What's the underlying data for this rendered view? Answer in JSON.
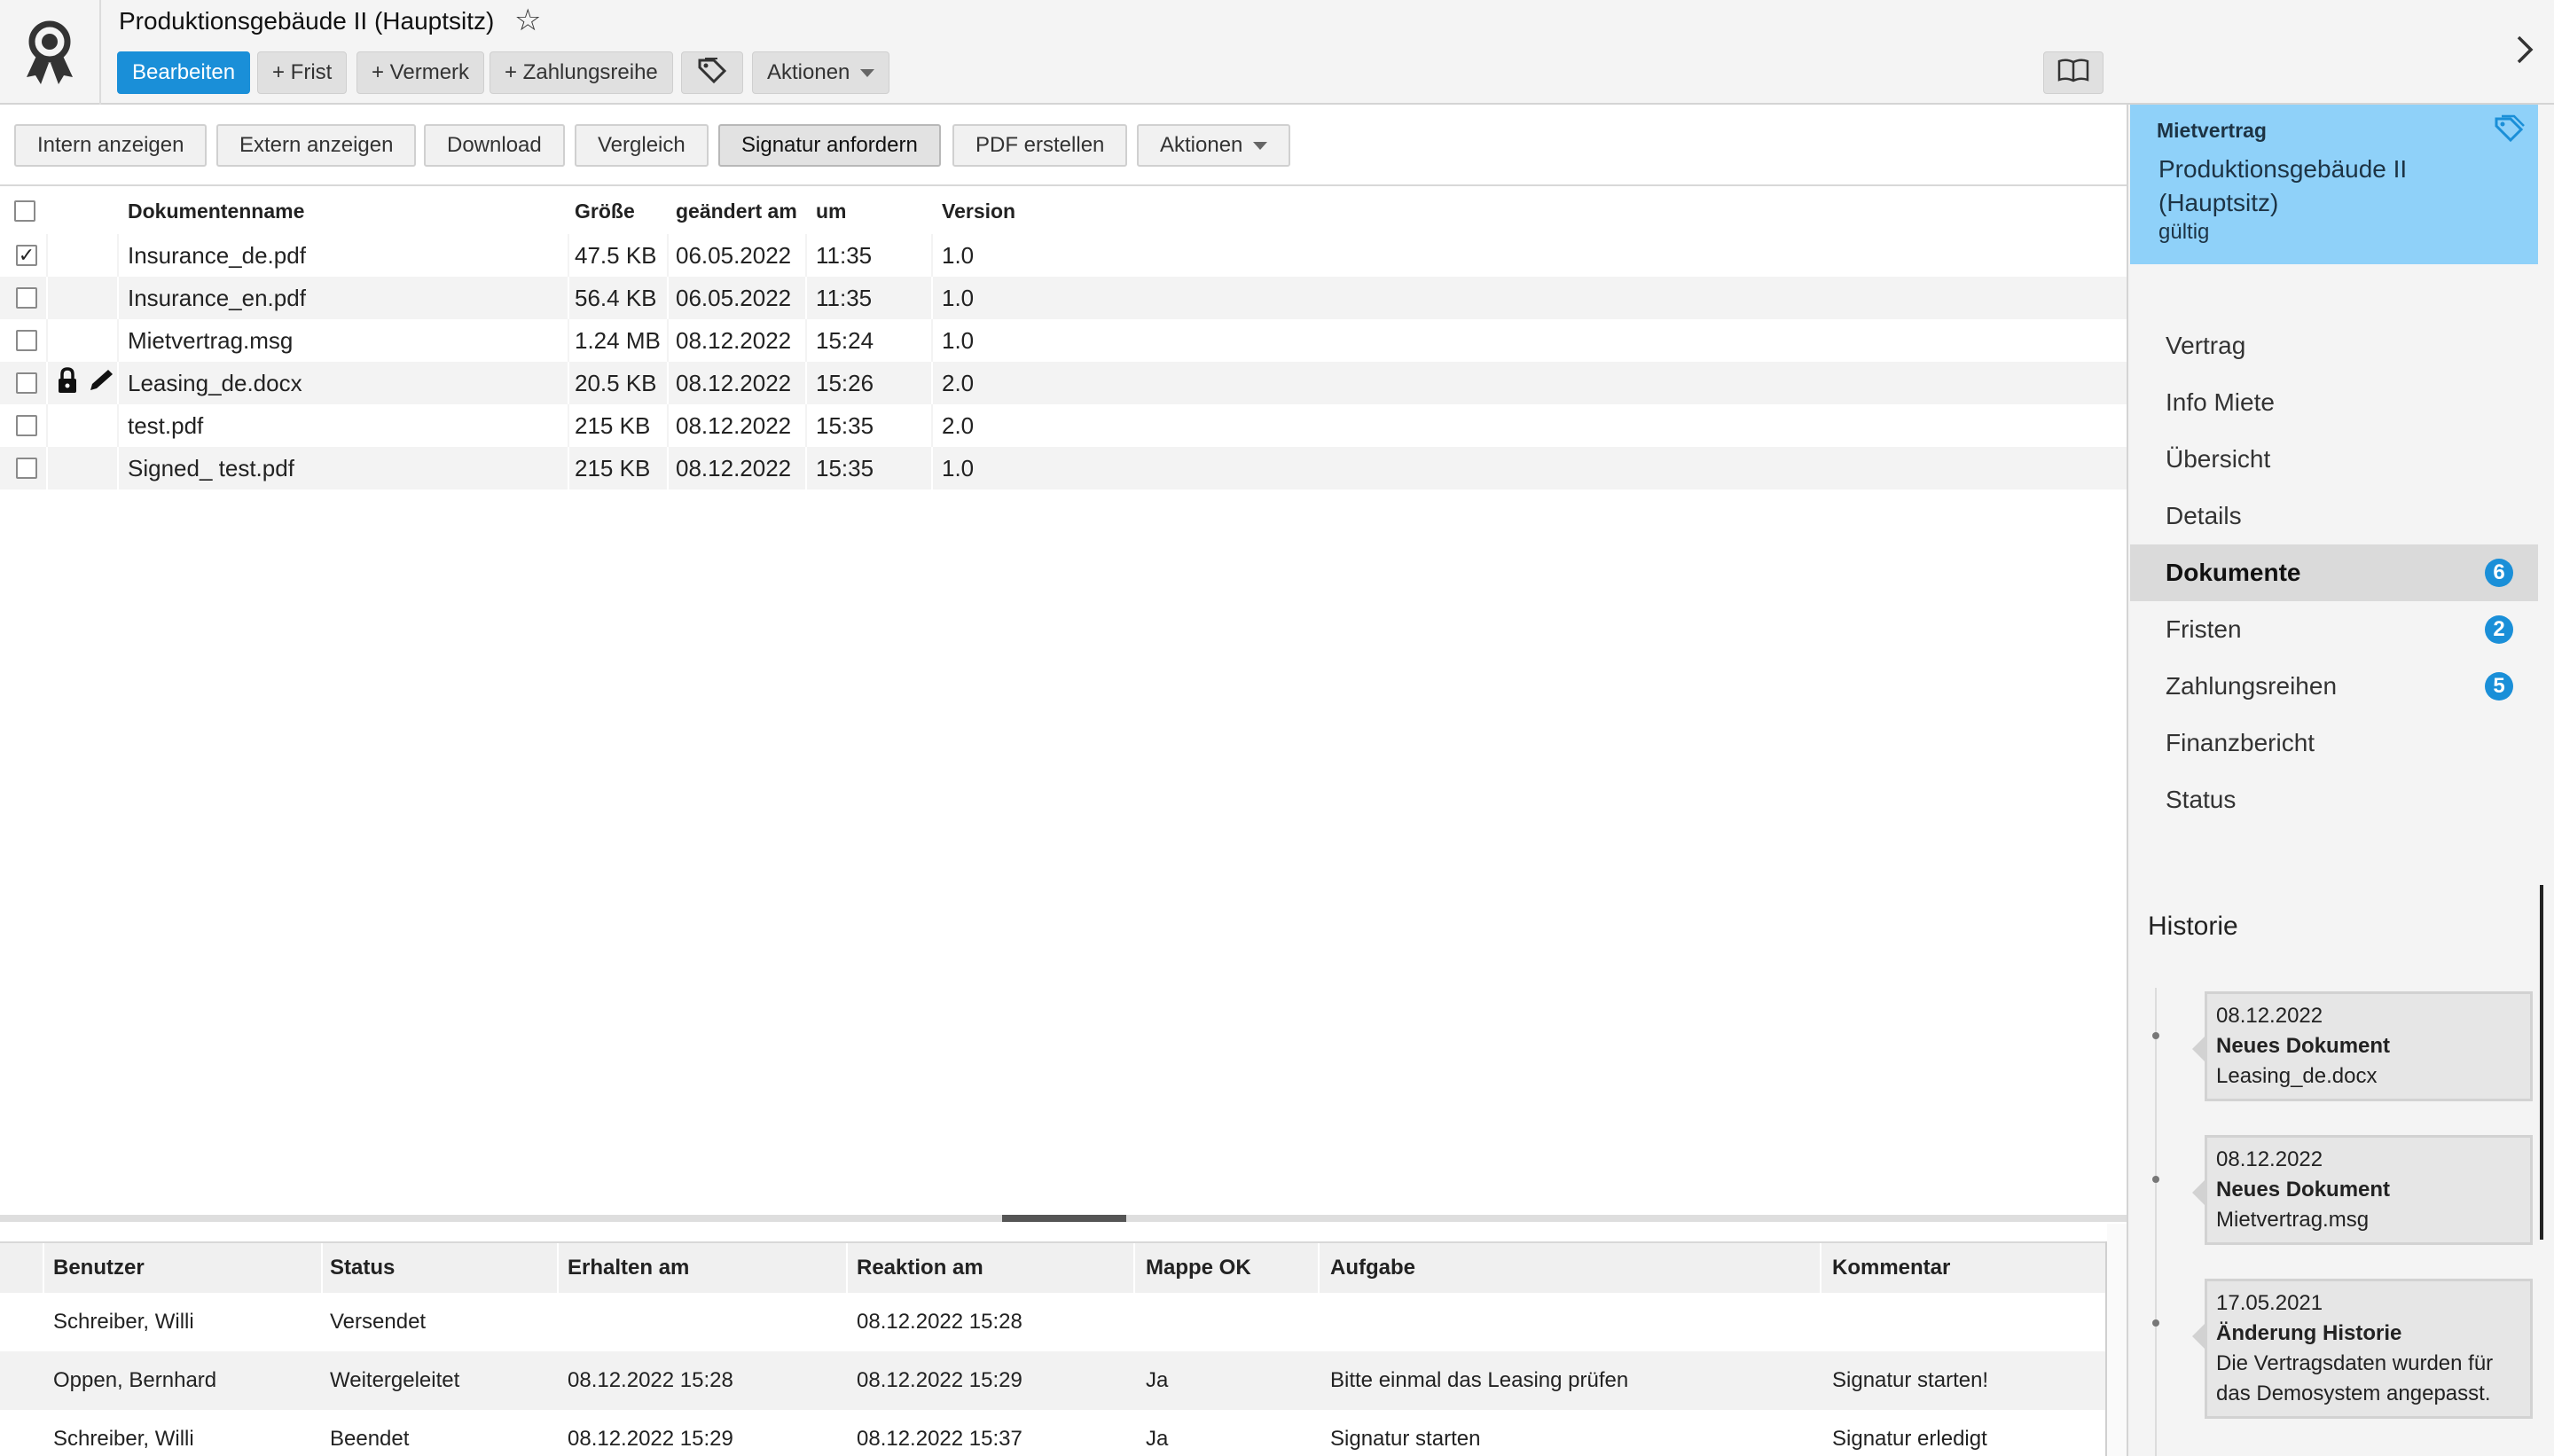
{
  "header": {
    "title": "Produktionsgebäude II (Hauptsitz)",
    "buttons": {
      "edit": "Bearbeiten",
      "deadline": "+ Frist",
      "note": "+ Vermerk",
      "payment": "+ Zahlungsreihe",
      "actions": "Aktionen"
    },
    "icons": [
      "award-logo-icon",
      "star-icon",
      "tags-icon",
      "book-icon",
      "chevron-right-icon"
    ]
  },
  "toolbar": {
    "show_internal": "Intern anzeigen",
    "show_external": "Extern anzeigen",
    "download": "Download",
    "compare": "Vergleich",
    "request_signature": "Signatur anfordern",
    "create_pdf": "PDF erstellen",
    "actions": "Aktionen"
  },
  "documents": {
    "columns": {
      "name": "Dokumentenname",
      "size": "Größe",
      "changed": "geändert am",
      "time": "um",
      "version": "Version"
    },
    "rows": [
      {
        "checked": true,
        "locked": false,
        "name": "Insurance_de.pdf",
        "size": "47.5 KB",
        "date": "06.05.2022",
        "time": "11:35",
        "version": "1.0"
      },
      {
        "checked": false,
        "locked": false,
        "name": "Insurance_en.pdf",
        "size": "56.4 KB",
        "date": "06.05.2022",
        "time": "11:35",
        "version": "1.0"
      },
      {
        "checked": false,
        "locked": false,
        "name": "Mietvertrag.msg",
        "size": "1.24 MB",
        "date": "08.12.2022",
        "time": "15:24",
        "version": "1.0"
      },
      {
        "checked": false,
        "locked": true,
        "name": "Leasing_de.docx",
        "size": "20.5 KB",
        "date": "08.12.2022",
        "time": "15:26",
        "version": "2.0"
      },
      {
        "checked": false,
        "locked": false,
        "name": "test.pdf",
        "size": "215 KB",
        "date": "08.12.2022",
        "time": "15:35",
        "version": "2.0"
      },
      {
        "checked": false,
        "locked": false,
        "name": "Signed_ test.pdf",
        "size": "215 KB",
        "date": "08.12.2022",
        "time": "15:35",
        "version": "1.0"
      }
    ]
  },
  "workflow": {
    "columns": {
      "user": "Benutzer",
      "status": "Status",
      "received": "Erhalten am",
      "reaction": "Reaktion am",
      "folder_ok": "Mappe OK",
      "task": "Aufgabe",
      "comment": "Kommentar"
    },
    "rows": [
      {
        "user": "Schreiber, Willi",
        "status": "Versendet",
        "received": "",
        "reaction": "08.12.2022 15:28",
        "folder_ok": "",
        "task": "",
        "comment": ""
      },
      {
        "user": "Oppen, Bernhard",
        "status": "Weitergeleitet",
        "received": "08.12.2022 15:28",
        "reaction": "08.12.2022 15:29",
        "folder_ok": "Ja",
        "task": "Bitte einmal das Leasing prüfen",
        "comment": "Signatur starten!"
      },
      {
        "user": "Schreiber, Willi",
        "status": "Beendet",
        "received": "08.12.2022 15:29",
        "reaction": "08.12.2022 15:37",
        "folder_ok": "Ja",
        "task": "Signatur starten",
        "comment": "Signatur erledigt"
      }
    ]
  },
  "panel": {
    "contract": {
      "type": "Mietvertrag",
      "name": "Produktionsgebäude II (Hauptsitz)",
      "status": "gültig"
    },
    "nav": [
      {
        "label": "Vertrag",
        "badge": ""
      },
      {
        "label": "Info Miete",
        "badge": ""
      },
      {
        "label": "Übersicht",
        "badge": ""
      },
      {
        "label": "Details",
        "badge": ""
      },
      {
        "label": "Dokumente",
        "badge": "6"
      },
      {
        "label": "Fristen",
        "badge": "2"
      },
      {
        "label": "Zahlungsreihen",
        "badge": "5"
      },
      {
        "label": "Finanzbericht",
        "badge": ""
      },
      {
        "label": "Status",
        "badge": ""
      }
    ],
    "active_nav": "Dokumente",
    "history_title": "Historie",
    "history": [
      {
        "date": "08.12.2022",
        "title": "Neues Dokument",
        "text": "Leasing_de.docx"
      },
      {
        "date": "08.12.2022",
        "title": "Neues Dokument",
        "text": "Mietvertrag.msg"
      },
      {
        "date": "17.05.2021",
        "title": "Änderung Historie",
        "text": "Die Vertragsdaten wurden für das Demosystem angepasst."
      }
    ]
  },
  "colors": {
    "primary": "#1a8fd8",
    "card": "#8fd1f9",
    "active_nav": "#dadada"
  }
}
